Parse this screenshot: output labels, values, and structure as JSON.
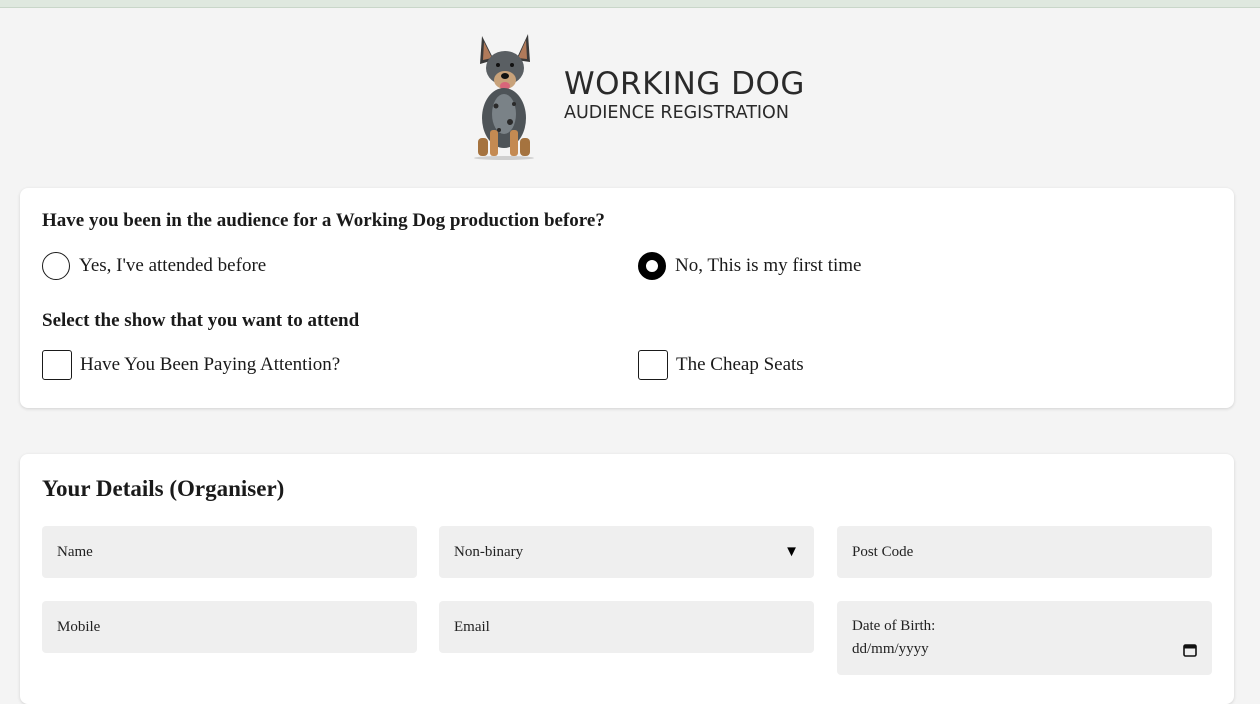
{
  "brand": {
    "title": "WORKING DOG",
    "subtitle": "AUDIENCE REGISTRATION",
    "logo_icon": "dog-logo"
  },
  "attendance": {
    "question": "Have you been in the audience for a Working Dog production before?",
    "options": [
      {
        "label": "Yes, I've attended before",
        "checked": false
      },
      {
        "label": "No, This is my first time",
        "checked": true
      }
    ]
  },
  "shows": {
    "question": "Select the show that you want to attend",
    "options": [
      {
        "label": "Have You Been Paying Attention?",
        "checked": false
      },
      {
        "label": "The Cheap Seats",
        "checked": false
      }
    ]
  },
  "details": {
    "title": "Your Details (Organiser)",
    "name_placeholder": "Name",
    "gender_value": "Non-binary",
    "postcode_placeholder": "Post Code",
    "mobile_placeholder": "Mobile",
    "email_placeholder": "Email",
    "dob_label": "Date of Birth:",
    "dob_placeholder": "dd/mm/yyyy"
  },
  "colors": {
    "background": "#f4f4f4",
    "card": "#ffffff",
    "field": "#efefef",
    "topbar": "#dfe8df"
  }
}
